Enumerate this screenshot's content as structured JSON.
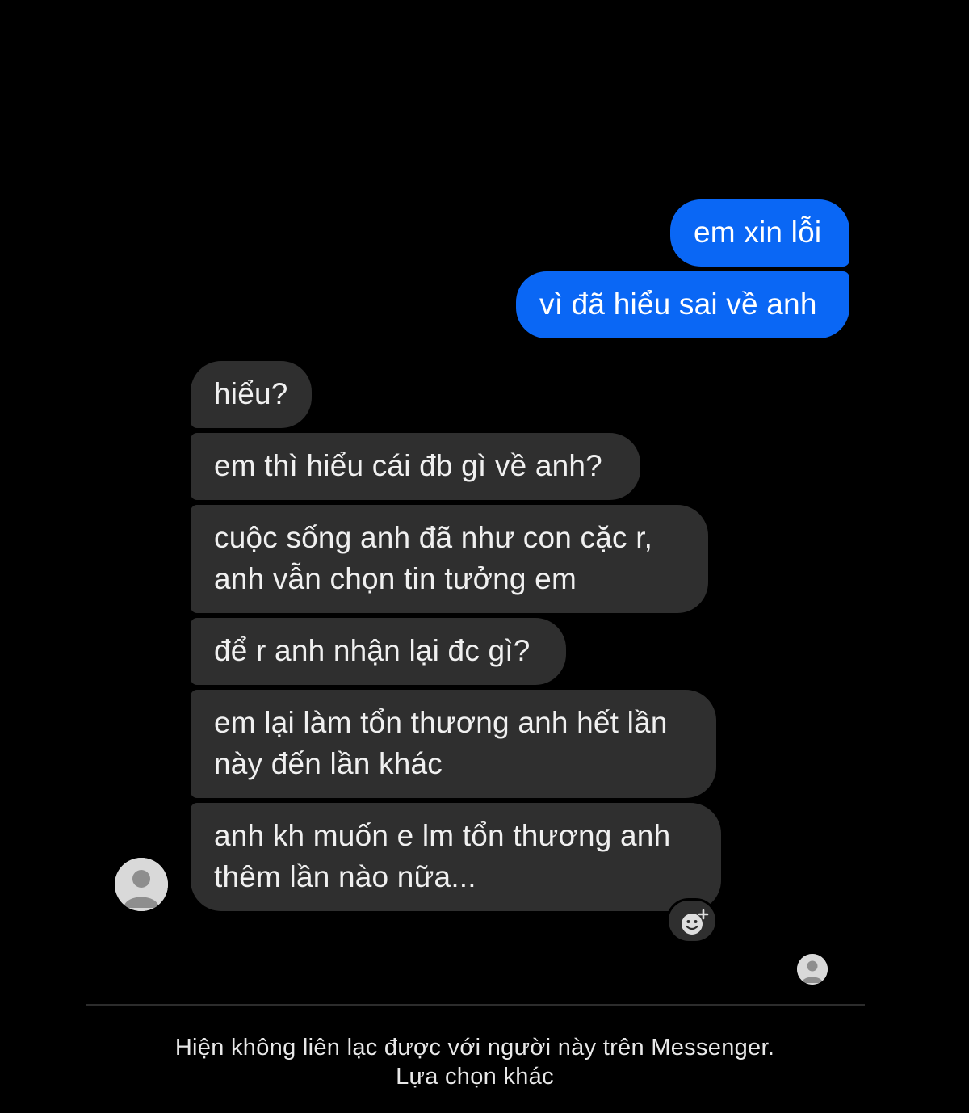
{
  "conversation": {
    "outgoing": [
      {
        "lines": [
          "em xin lỗi"
        ]
      },
      {
        "lines": [
          "vì đã hiểu sai về anh"
        ]
      }
    ],
    "incoming": [
      {
        "lines": [
          "hiểu?"
        ]
      },
      {
        "lines": [
          "em thì hiểu cái đb gì về anh?"
        ]
      },
      {
        "lines": [
          "cuộc sống anh đã như con cặc r,",
          "anh vẫn chọn tin tưởng em"
        ]
      },
      {
        "lines": [
          "để r anh nhận lại đc gì?"
        ]
      },
      {
        "lines": [
          "em lại làm tổn thương anh hết lần",
          "này đến lần khác"
        ]
      },
      {
        "lines": [
          "anh kh muốn e lm tổn thương anh",
          "thêm lần nào nữa..."
        ]
      }
    ]
  },
  "footer": {
    "notice": "Hiện không liên lạc được với người này trên Messenger.",
    "link": "Lựa chọn khác"
  },
  "icons": {
    "contact_avatar": "default-avatar-icon",
    "seen_avatar": "seen-avatar-icon",
    "reaction": "add-reaction-icon"
  },
  "colors": {
    "background": "#000000",
    "outgoing_bubble": "#0a67f5",
    "incoming_bubble": "#2f2f2f",
    "text": "#f0f0f0"
  }
}
